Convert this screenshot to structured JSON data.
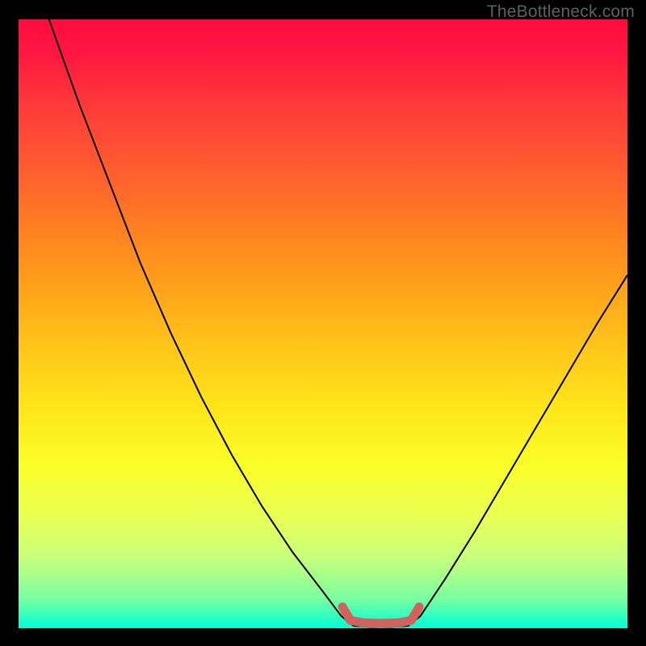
{
  "watermark": {
    "text": "TheBottleneck.com"
  },
  "chart_data": {
    "type": "line",
    "title": "",
    "xlabel": "",
    "ylabel": "",
    "xlim": [
      0,
      100
    ],
    "ylim": [
      0,
      100
    ],
    "grid": false,
    "legend": false,
    "annotations": [],
    "series": [
      {
        "name": "curve",
        "stroke": "#000000",
        "stroke_width": 2,
        "points": [
          {
            "x": 5.0,
            "y": 100.0
          },
          {
            "x": 10.0,
            "y": 86.0
          },
          {
            "x": 15.0,
            "y": 73.0
          },
          {
            "x": 20.0,
            "y": 60.0
          },
          {
            "x": 25.0,
            "y": 48.5
          },
          {
            "x": 30.0,
            "y": 38.0
          },
          {
            "x": 35.0,
            "y": 28.5
          },
          {
            "x": 40.0,
            "y": 20.0
          },
          {
            "x": 45.0,
            "y": 12.5
          },
          {
            "x": 50.0,
            "y": 6.0
          },
          {
            "x": 53.0,
            "y": 2.0
          },
          {
            "x": 55.0,
            "y": 0.4
          },
          {
            "x": 58.0,
            "y": 0.2
          },
          {
            "x": 61.0,
            "y": 0.2
          },
          {
            "x": 64.0,
            "y": 0.4
          },
          {
            "x": 66.0,
            "y": 2.0
          },
          {
            "x": 70.0,
            "y": 8.0
          },
          {
            "x": 75.0,
            "y": 16.0
          },
          {
            "x": 80.0,
            "y": 24.5
          },
          {
            "x": 85.0,
            "y": 33.0
          },
          {
            "x": 90.0,
            "y": 41.5
          },
          {
            "x": 95.0,
            "y": 50.0
          },
          {
            "x": 100.0,
            "y": 58.0
          }
        ]
      },
      {
        "name": "optimal-zone-marker",
        "stroke": "#d4615d",
        "stroke_width": 11,
        "linecap": "round",
        "points": [
          {
            "x": 53.2,
            "y": 3.5
          },
          {
            "x": 54.5,
            "y": 1.3
          },
          {
            "x": 56.5,
            "y": 0.9
          },
          {
            "x": 59.5,
            "y": 0.8
          },
          {
            "x": 62.5,
            "y": 0.9
          },
          {
            "x": 64.5,
            "y": 1.3
          },
          {
            "x": 65.8,
            "y": 3.5
          }
        ]
      }
    ]
  }
}
